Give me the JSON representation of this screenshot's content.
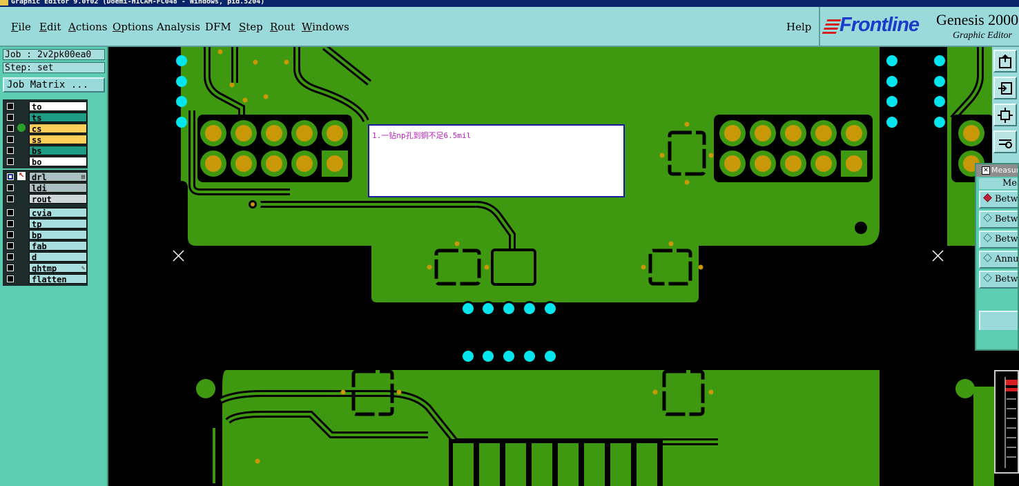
{
  "window": {
    "title": "Graphic Editor 9.0f02 (Doemi-HICAM-FC048 - Windows, pid.5204)"
  },
  "menu": {
    "items": [
      {
        "mn": "F",
        "rest": "ile"
      },
      {
        "mn": "E",
        "rest": "dit"
      },
      {
        "mn": "A",
        "rest": "ctions"
      },
      {
        "mn": "O",
        "rest": "ptions"
      },
      {
        "mn": "",
        "rest": "Analysis"
      },
      {
        "mn": "",
        "rest": "DFM"
      },
      {
        "mn": "S",
        "rest": "tep"
      },
      {
        "mn": "R",
        "rest": "out"
      },
      {
        "mn": "W",
        "rest": "indows"
      }
    ],
    "help": "Help"
  },
  "brand": {
    "logo": "Frontline",
    "product": "Genesis 2000",
    "subtitle": "Graphic Editor"
  },
  "job": {
    "job_label": "Job : 2v2pk00ea0",
    "step_label": "Step: set",
    "matrix_button": "Job Matrix ..."
  },
  "layers": {
    "group1": [
      {
        "name": "to",
        "color": "white"
      },
      {
        "name": "ts",
        "color": "teal"
      },
      {
        "name": "cs",
        "color": "yellow",
        "mark": "dot"
      },
      {
        "name": "ss",
        "color": "yellow"
      },
      {
        "name": "bs",
        "color": "teal"
      },
      {
        "name": "bo",
        "color": "white"
      }
    ],
    "group2": [
      {
        "name": "drl",
        "color": "gray",
        "active": true,
        "mark": "arrow",
        "suffix": "⊞"
      },
      {
        "name": "ldi",
        "color": "gray"
      },
      {
        "name": "rout",
        "color": "light"
      }
    ],
    "group3": [
      {
        "name": "cvia",
        "color": "cyan"
      },
      {
        "name": "tp",
        "color": "cyan"
      },
      {
        "name": "bp",
        "color": "cyan"
      },
      {
        "name": "fab",
        "color": "cyan"
      },
      {
        "name": "d",
        "color": "cyan"
      },
      {
        "name": "ghtmp",
        "color": "cyan",
        "suffix": "✎"
      },
      {
        "name": "flatten",
        "color": "cyan"
      }
    ]
  },
  "note": {
    "text": "1.一钻np孔到铜不足6.5mil"
  },
  "measure": {
    "title": "Measure",
    "header": "Mea",
    "options": [
      "Betw",
      "Betw",
      "Betw",
      "Annu",
      "Betw"
    ]
  },
  "colors": {
    "copper": "#3f9910",
    "pad": "#c89808",
    "via": "#00e5ee",
    "background": "#000000",
    "panel": "#5ccdb0",
    "menu": "#9bdada"
  }
}
